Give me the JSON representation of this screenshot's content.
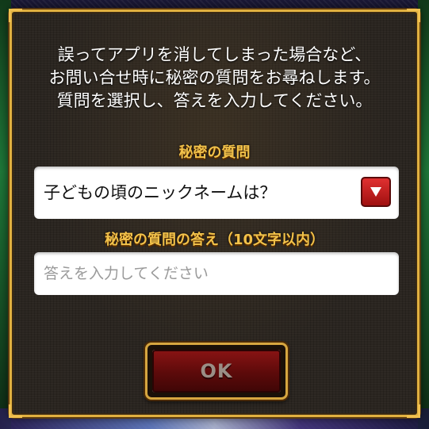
{
  "dialog": {
    "intro_lines": [
      "誤ってアプリを消してしまった場合など、",
      "お問い合せ時に秘密の質問をお尋ねします。",
      "質問を選択し、答えを入力してください。"
    ],
    "question_label": "秘密の質問",
    "question_selected": "子どもの頃のニックネームは？",
    "answer_label": "秘密の質問の答え（10文字以内）",
    "answer_value": "",
    "answer_placeholder": "答えを入力してください",
    "ok_label": "OK"
  },
  "colors": {
    "label_gold": "#f2c24a",
    "frame_gold": "#e0b040",
    "ok_red": "#8a1414",
    "dropdown_red": "#e03030"
  },
  "icons": {
    "dropdown": "triangle-down-icon"
  }
}
